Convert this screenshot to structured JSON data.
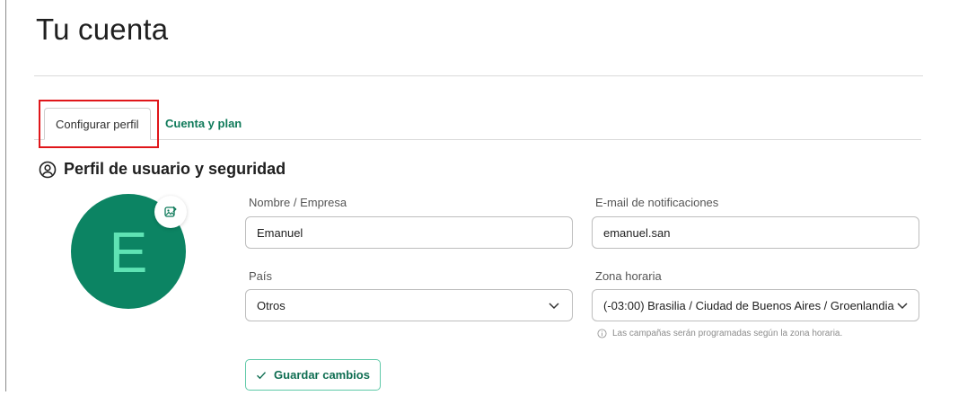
{
  "page": {
    "title": "Tu cuenta"
  },
  "tabs": [
    {
      "label": "Configurar perfil",
      "active": true
    },
    {
      "label": "Cuenta y plan",
      "active": false
    }
  ],
  "profile": {
    "section_title": "Perfil de usuario y seguridad",
    "avatar_letter": "E",
    "fields": {
      "name": {
        "label": "Nombre / Empresa",
        "value": "Emanuel"
      },
      "email": {
        "label": "E-mail de notificaciones",
        "value": "emanuel.san"
      },
      "country": {
        "label": "País",
        "value": "Otros"
      },
      "timezone": {
        "label": "Zona horaria",
        "value": "(-03:00) Brasilia / Ciudad de Buenos Aires / Groenlandia"
      }
    },
    "timezone_hint": "Las campañas serán programadas según la zona horaria.",
    "save_label": "Guardar cambios"
  },
  "colors": {
    "accent": "#0f7a5a",
    "avatar_bg": "#0c8463",
    "highlight": "#e0161a"
  }
}
